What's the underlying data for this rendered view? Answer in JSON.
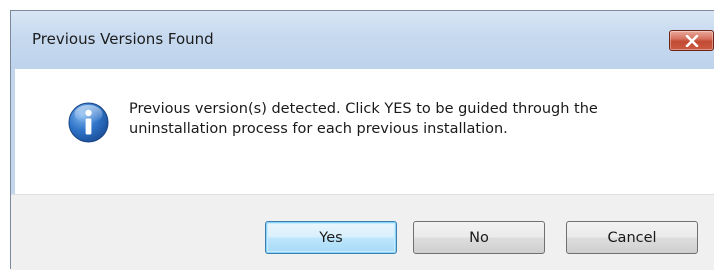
{
  "window": {
    "title": "Previous Versions Found"
  },
  "message": {
    "line1": "Previous version(s) detected. Click YES to be guided through the",
    "line2": "uninstallation process for each previous installation."
  },
  "buttons": {
    "yes": "Yes",
    "no": "No",
    "cancel": "Cancel",
    "default": "yes"
  },
  "icons": {
    "message_icon": "information-icon",
    "close_icon": "close-icon"
  },
  "colors": {
    "titlebar": "#c6d9ef",
    "close_button": "#c34a33",
    "footer": "#f0f0f0",
    "default_button": "#bee6fd"
  }
}
